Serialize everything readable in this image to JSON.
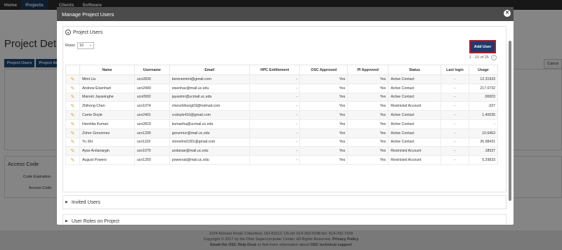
{
  "topnav": {
    "items": [
      "Home",
      "Projects",
      "Clients",
      "Software"
    ]
  },
  "background": {
    "page_title": "Project Deta",
    "tabs": [
      "Project Users",
      "Project Att"
    ],
    "cancel_label": "Cance",
    "access_code": {
      "title": "Access Code",
      "expiration_label": "Code Expiration",
      "code_label": "Access Code"
    },
    "footer": {
      "address": "1224 Kinnear Road, Columbus, OH 43212, US   tel: 614-292-9248   fax: 614-292-7168",
      "copyright": "Copyright © 2017 by the Ohio Supercomputer Center. All Rights Reserved.",
      "privacy": "Privacy Policy",
      "help": "Email the OSC Help Desk",
      "help_suffix": "or find more information about",
      "support": "OSC technical support"
    }
  },
  "modal": {
    "title": "Manage Project Users",
    "close_glyph": "✕",
    "sections": {
      "project_users": "Project Users",
      "invited_users": "Invited Users",
      "user_roles": "User Roles on Project"
    },
    "rows_label": "Rows",
    "rows_value": "10",
    "add_user_label": "Add User",
    "pager_text": "1 - 10 of 25",
    "columns": [
      "",
      "Name",
      "Username",
      "Email",
      "HPC Entitlement",
      "OSC Approved",
      "PI Approved",
      "Status",
      "Last login",
      "Usage"
    ],
    "rows": [
      {
        "name": "Mimi Liu",
        "username": "ucn2830",
        "email": "berenemimi@gmail.com",
        "hpc": "-",
        "osc": "Yes",
        "pi": "Yes",
        "status": "Active Contact",
        "last_login": "-",
        "usage": "12.31933"
      },
      {
        "name": "Andrew Eisenhart",
        "username": "ucn2400",
        "email": "eisenhav@mail.uc.edu",
        "hpc": "-",
        "osc": "Yes",
        "pi": "Yes",
        "status": "Active Contact",
        "last_login": "-",
        "usage": "217.0732"
      },
      {
        "name": "Manoiri Jayasinghe",
        "username": "ucn0992",
        "email": "jayasimr@ucmail.uc.edu",
        "hpc": "-",
        "osc": "Yes",
        "pi": "Yes",
        "status": "Active Contact",
        "last_login": "-",
        "usage": ".00003"
      },
      {
        "name": "Zhihong Chen",
        "username": "ucn1074",
        "email": "chenzhihong03@hotmail.com",
        "hpc": "-",
        "osc": "Yes",
        "pi": "Yes",
        "status": "Restricted Account",
        "last_login": "-",
        "usage": ".037"
      },
      {
        "name": "Carrie Doyle",
        "username": "ucn2401",
        "email": "ccdoyle416@gmail.com",
        "hpc": "-",
        "osc": "Yes",
        "pi": "Yes",
        "status": "Active Contact",
        "last_login": "-",
        "usage": "1.40035"
      },
      {
        "name": "Harshita Kumari",
        "username": "ucn2819",
        "email": "kumariha@ucmail.uc.edu",
        "hpc": "-",
        "osc": "Yes",
        "pi": "Yes",
        "status": "Active Contact",
        "last_login": "-",
        "usage": "-"
      },
      {
        "name": "Zohre Gorunmez",
        "username": "ucn1290",
        "email": "gorunmzr@mail.uc.edu",
        "hpc": "-",
        "osc": "Yes",
        "pi": "Yes",
        "status": "Active Contact",
        "last_login": "-",
        "usage": "10.6463"
      },
      {
        "name": "Yu Shi",
        "username": "ucn1118",
        "email": "stonelmd1301@gmail.com",
        "hpc": "-",
        "osc": "Yes",
        "pi": "Yes",
        "status": "Active Contact",
        "last_login": "-",
        "usage": "26.98431"
      },
      {
        "name": "Ayse Arslanargin",
        "username": "ucn1076",
        "email": "arslanae@mail.uc.edu",
        "hpc": "-",
        "osc": "Yes",
        "pi": "Yes",
        "status": "Restricted Account",
        "last_login": "-",
        "usage": ".18537"
      },
      {
        "name": "August Powers",
        "username": "ucn1250",
        "email": "powersat@mail.uc.edu",
        "hpc": "-",
        "osc": "Yes",
        "pi": "Yes",
        "status": "Restricted Account",
        "last_login": "-",
        "usage": "5.29833"
      }
    ]
  },
  "colors": {
    "navbar": "#2c2c2c",
    "modal_header": "#4b4b4b",
    "primary_button": "#1e3a6e",
    "highlight_outline": "#c0141e",
    "pencil": "#e09b14"
  }
}
